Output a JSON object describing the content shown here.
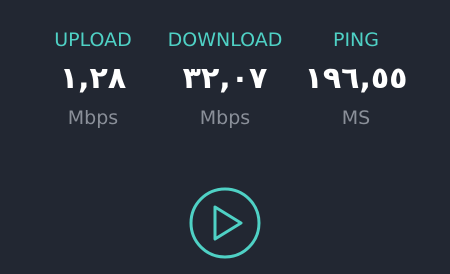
{
  "colors": {
    "background": "#222732",
    "accent": "#4fd1c5",
    "value": "#ffffff",
    "unit": "#8a8f99"
  },
  "stats": [
    {
      "label": "UPLOAD",
      "value": "١,٢٨",
      "unit": "Mbps"
    },
    {
      "label": "DOWNLOAD",
      "value": "٣٢,٠٧",
      "unit": "Mbps"
    },
    {
      "label": "PING",
      "value": "١٩٦,٥٥",
      "unit": "MS"
    }
  ],
  "play_button": {
    "icon": "play-icon"
  }
}
